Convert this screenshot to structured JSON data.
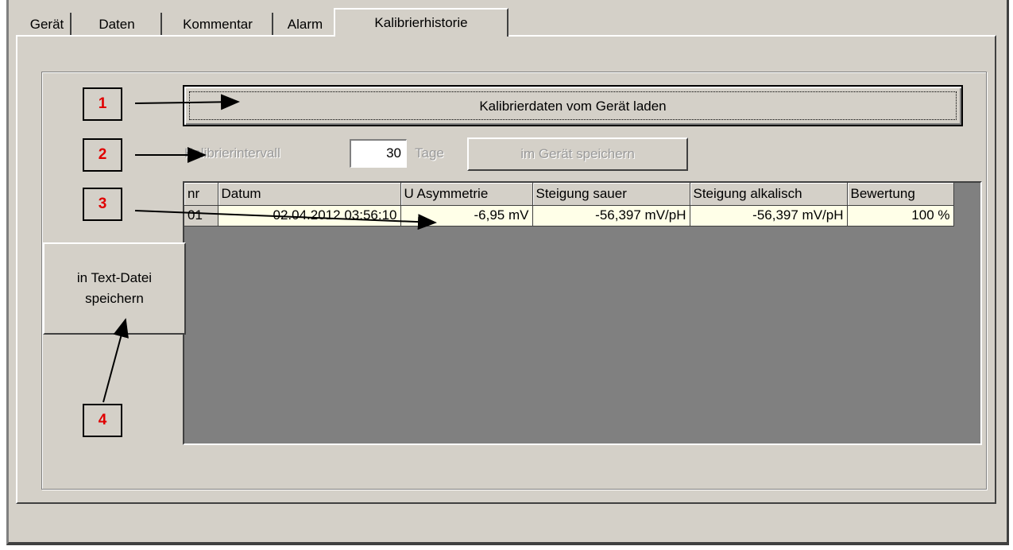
{
  "tabs": [
    {
      "label": "Gerät"
    },
    {
      "label": "Daten"
    },
    {
      "label": "Kommentar"
    },
    {
      "label": "Alarm"
    },
    {
      "label": "Kalibrierhistorie"
    }
  ],
  "active_tab": "Kalibrierhistorie",
  "load_button": {
    "label": "Kalibrierdaten vom Gerät laden"
  },
  "interval": {
    "label": "Kalibrierintervall",
    "value": "30",
    "unit": "Tage",
    "store_button": "im Gerät speichern"
  },
  "table": {
    "columns": [
      "nr",
      "Datum",
      "U Asymmetrie",
      "Steigung sauer",
      "Steigung alkalisch",
      "Bewertung"
    ],
    "rows": [
      {
        "nr": "01",
        "datum": "02.04.2012 03:56:10",
        "u_asym": "-6,95 mV",
        "st_sauer": "-56,397 mV/pH",
        "st_alk": "-56,397 mV/pH",
        "bewertung": "100 %"
      }
    ]
  },
  "textfile_button": {
    "line1": "in Text-Datei",
    "line2": "speichern"
  },
  "callouts": [
    "1",
    "2",
    "3",
    "4"
  ],
  "colors": {
    "callout_text": "#e00000",
    "window_bg": "#d4d0c8",
    "grid_bg": "#808080",
    "cell_bg": "#ffffe8"
  }
}
